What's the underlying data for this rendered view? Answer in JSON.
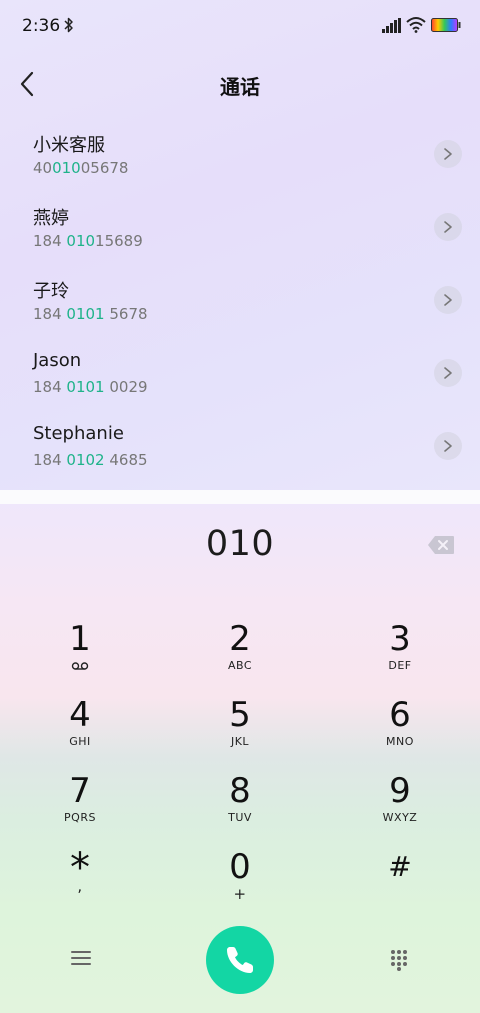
{
  "status_bar": {
    "time": "2:36",
    "icons": [
      "bluetooth-icon",
      "signal-icon",
      "wifi-icon",
      "battery-icon"
    ]
  },
  "header": {
    "title": "通话",
    "back_icon": "chevron-left-icon"
  },
  "contacts": [
    {
      "name": "小米客服",
      "number_parts": [
        "40",
        "010",
        "05678"
      ]
    },
    {
      "name": "燕婷",
      "number_parts": [
        "184 ",
        "010",
        "15689"
      ]
    },
    {
      "name": "子玲",
      "number_parts": [
        "184 ",
        "0101",
        " 5678"
      ]
    },
    {
      "name": "Jason",
      "number_parts": [
        "184 ",
        "0101",
        " 0029"
      ]
    },
    {
      "name": "Stephanie",
      "number_parts": [
        "184 ",
        "0102",
        " 4685"
      ]
    }
  ],
  "dial": {
    "entered_number": "010",
    "backspace_icon": "backspace-icon"
  },
  "keypad": [
    {
      "digit": "1",
      "letters": "",
      "sub_icon": "voicemail-icon"
    },
    {
      "digit": "2",
      "letters": "ABC"
    },
    {
      "digit": "3",
      "letters": "DEF"
    },
    {
      "digit": "4",
      "letters": "GHI"
    },
    {
      "digit": "5",
      "letters": "JKL"
    },
    {
      "digit": "6",
      "letters": "MNO"
    },
    {
      "digit": "7",
      "letters": "PQRS"
    },
    {
      "digit": "8",
      "letters": "TUV"
    },
    {
      "digit": "9",
      "letters": "WXYZ"
    },
    {
      "digit": "*",
      "letters": ","
    },
    {
      "digit": "0",
      "letters": "+"
    },
    {
      "digit": "#",
      "letters": ""
    }
  ],
  "bottom_bar": {
    "menu_icon": "menu-icon",
    "call_icon": "phone-icon",
    "keypad_icon": "dialpad-icon"
  },
  "colors": {
    "highlight": "#1fb38a",
    "call_button": "#13d6a4"
  }
}
